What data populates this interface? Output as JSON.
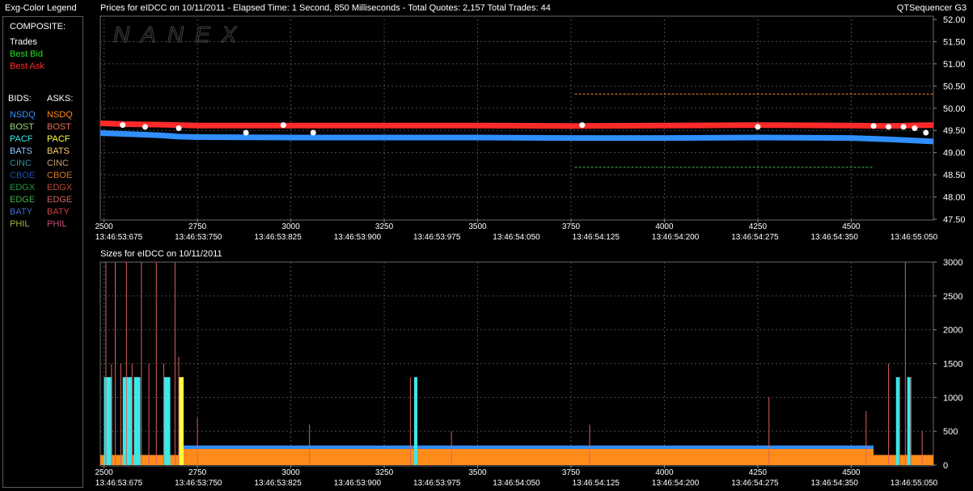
{
  "legend": {
    "title": "Exg-Color Legend",
    "composite_label": "COMPOSITE:",
    "composite": [
      {
        "label": "Trades",
        "color": "#ffffff"
      },
      {
        "label": "Best Bid",
        "color": "#22e022"
      },
      {
        "label": "Best Ask",
        "color": "#ff2a2a"
      }
    ],
    "bids_label": "BIDS:",
    "asks_label": "ASKS:",
    "bids": [
      {
        "label": "NSDQ",
        "color": "#2f8fff"
      },
      {
        "label": "BOST",
        "color": "#9bd37a"
      },
      {
        "label": "PACF",
        "color": "#3ee8e8"
      },
      {
        "label": "BATS",
        "color": "#8fc8ff"
      },
      {
        "label": "CINC",
        "color": "#3a8aa0"
      },
      {
        "label": "CBOE",
        "color": "#1f4fb0"
      },
      {
        "label": "EDGX",
        "color": "#1f9a3a"
      },
      {
        "label": "EDGE",
        "color": "#44b044"
      },
      {
        "label": "BATY",
        "color": "#3f6ac8"
      },
      {
        "label": "PHIL",
        "color": "#9ab84a"
      }
    ],
    "asks": [
      {
        "label": "NSDQ",
        "color": "#ff8c1a"
      },
      {
        "label": "BOST",
        "color": "#e07060"
      },
      {
        "label": "PACF",
        "color": "#ffff40"
      },
      {
        "label": "BATS",
        "color": "#ffd070"
      },
      {
        "label": "CINC",
        "color": "#c0a070"
      },
      {
        "label": "CBOE",
        "color": "#d27a2a"
      },
      {
        "label": "EDGX",
        "color": "#c04830"
      },
      {
        "label": "EDGE",
        "color": "#d86060"
      },
      {
        "label": "BATY",
        "color": "#d04040"
      },
      {
        "label": "PHIL",
        "color": "#c85070"
      }
    ]
  },
  "header": {
    "prices_title": "Prices for  eIDCC  on  10/11/2011   -  Elapsed Time: 1 Second, 850 Milliseconds   -  Total Quotes: 2,157   Total Trades: 44",
    "product": "QTSequencer G3",
    "watermark": "NANEX",
    "sizes_title": "Sizes for  eIDCC  on  10/11/2011"
  },
  "chart_data": [
    {
      "type": "line",
      "title": "Prices for eIDCC on 10/11/2011",
      "xlim": [
        2490,
        4720
      ],
      "ylim": [
        47.5,
        52.0
      ],
      "x_ticks": [
        2500,
        2750,
        3000,
        3250,
        3500,
        3750,
        4000,
        4250,
        4500
      ],
      "time_ticks": [
        "13:46:53:675",
        "13:46:53:750",
        "13:46:53:825",
        "13:46:53:900",
        "13:46:53:975",
        "13:46:54:050",
        "13:46:54:125",
        "13:46:54:200",
        "13:46:54:275",
        "13:46:54:350",
        "13:46:55:050"
      ],
      "y_ticks": [
        "52.00",
        "51.50",
        "51.00",
        "50.50",
        "50.00",
        "49.50",
        "49.00",
        "48.50",
        "48.00",
        "47.50"
      ],
      "series": [
        {
          "role": "best-ask",
          "color": "#ff2a2a",
          "points": [
            [
              2490,
              49.66
            ],
            [
              2560,
              49.64
            ],
            [
              2650,
              49.63
            ],
            [
              2700,
              49.62
            ],
            [
              2750,
              49.61
            ],
            [
              3000,
              49.61
            ],
            [
              3500,
              49.61
            ],
            [
              3750,
              49.6
            ],
            [
              4000,
              49.61
            ],
            [
              4250,
              49.62
            ],
            [
              4500,
              49.61
            ],
            [
              4600,
              49.6
            ],
            [
              4720,
              49.62
            ]
          ]
        },
        {
          "role": "best-bid",
          "color": "#2f8fff",
          "points": [
            [
              2490,
              49.44
            ],
            [
              2560,
              49.42
            ],
            [
              2650,
              49.39
            ],
            [
              2700,
              49.36
            ],
            [
              2750,
              49.35
            ],
            [
              3000,
              49.34
            ],
            [
              3500,
              49.34
            ],
            [
              3750,
              49.33
            ],
            [
              4000,
              49.33
            ],
            [
              4250,
              49.34
            ],
            [
              4500,
              49.33
            ],
            [
              4600,
              49.3
            ],
            [
              4720,
              49.25
            ]
          ]
        },
        {
          "role": "ask-level",
          "color": "#ff8c1a",
          "points": [
            [
              3760,
              50.32
            ],
            [
              4720,
              50.32
            ]
          ]
        },
        {
          "role": "bid-level",
          "color": "#44b044",
          "points": [
            [
              3760,
              48.67
            ],
            [
              4560,
              48.67
            ]
          ]
        }
      ],
      "trades": [
        [
          2550,
          49.62
        ],
        [
          2610,
          49.58
        ],
        [
          2700,
          49.55
        ],
        [
          2880,
          49.45
        ],
        [
          2980,
          49.62
        ],
        [
          3060,
          49.45
        ],
        [
          3780,
          49.62
        ],
        [
          4250,
          49.58
        ],
        [
          4560,
          49.6
        ],
        [
          4600,
          49.58
        ],
        [
          4640,
          49.58
        ],
        [
          4670,
          49.55
        ],
        [
          4700,
          49.45
        ]
      ]
    },
    {
      "type": "bar",
      "title": "Sizes for eIDCC on 10/11/2011",
      "xlim": [
        2490,
        4720
      ],
      "ylim": [
        0,
        3000
      ],
      "x_ticks": [
        2500,
        2750,
        3000,
        3250,
        3500,
        3750,
        4000,
        4250,
        4500
      ],
      "time_ticks": [
        "13:46:53:675",
        "13:46:53:750",
        "13:46:53:825",
        "13:46:53:900",
        "13:46:53:975",
        "13:46:54:050",
        "13:46:54:125",
        "13:46:54:200",
        "13:46:54:275",
        "13:46:54:350",
        "13:46:55:050"
      ],
      "y_ticks": [
        "3000",
        "2500",
        "2000",
        "1500",
        "1000",
        "500",
        "0"
      ],
      "bands": [
        {
          "from": 2490,
          "to": 4720,
          "lo": 0,
          "hi": 150,
          "color": "#ff8c1a"
        },
        {
          "from": 2700,
          "to": 4560,
          "lo": 150,
          "hi": 240,
          "color": "#ff8c1a"
        },
        {
          "from": 2700,
          "to": 4560,
          "lo": 240,
          "hi": 290,
          "color": "#2f8fff"
        }
      ],
      "columns": [
        {
          "x": 2500,
          "w": 10,
          "v": 1300,
          "color": "#3ee8e8"
        },
        {
          "x": 2550,
          "w": 12,
          "v": 1300,
          "color": "#3ee8e8"
        },
        {
          "x": 2580,
          "w": 8,
          "v": 1300,
          "color": "#3ee8e8"
        },
        {
          "x": 2660,
          "w": 8,
          "v": 1300,
          "color": "#3ee8e8"
        },
        {
          "x": 2700,
          "w": 6,
          "v": 1300,
          "color": "#ffff40"
        },
        {
          "x": 3330,
          "w": 4,
          "v": 1300,
          "color": "#3ee8e8"
        },
        {
          "x": 4620,
          "w": 4,
          "v": 1300,
          "color": "#3ee8e8"
        },
        {
          "x": 4650,
          "w": 4,
          "v": 1300,
          "color": "#3ee8e8"
        }
      ],
      "spikes": [
        [
          2505,
          3000
        ],
        [
          2530,
          3000
        ],
        [
          2560,
          3000
        ],
        [
          2600,
          3000
        ],
        [
          2640,
          3000
        ],
        [
          2690,
          3000
        ],
        [
          4645,
          3000
        ],
        [
          2520,
          1500
        ],
        [
          2545,
          1500
        ],
        [
          2575,
          1500
        ],
        [
          2620,
          1500
        ],
        [
          2660,
          1500
        ],
        [
          2700,
          1600
        ],
        [
          3320,
          1300
        ],
        [
          4540,
          800
        ],
        [
          4600,
          1500
        ],
        [
          4630,
          1300
        ],
        [
          4660,
          1300
        ],
        [
          4690,
          500
        ],
        [
          2750,
          700
        ],
        [
          3050,
          600
        ],
        [
          3430,
          500
        ],
        [
          3800,
          600
        ],
        [
          4280,
          1000
        ]
      ]
    }
  ]
}
